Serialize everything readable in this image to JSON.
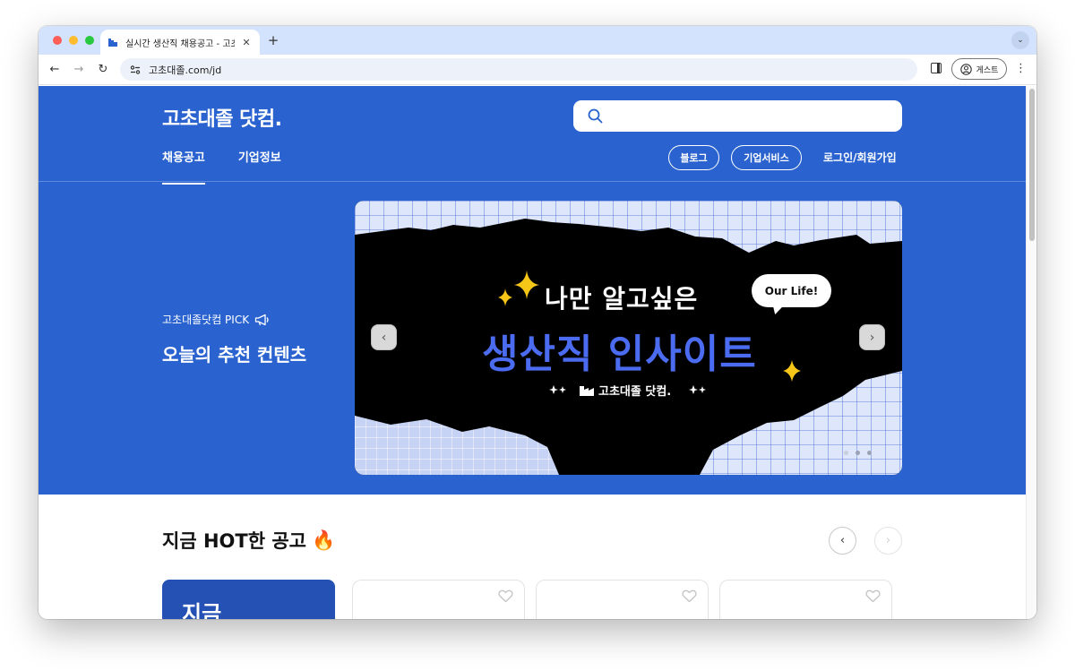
{
  "browser": {
    "tab_title": "실시간 생산직 채용공고 - 고초대졸",
    "tab_close": "✕",
    "new_tab": "+",
    "tab_search": "⌄",
    "url": "고초대졸.com/jd",
    "profile_label": "게스트",
    "menu": "⋮",
    "back": "←",
    "forward": "→",
    "reload": "↻"
  },
  "header": {
    "logo": "고초대졸 닷컴.",
    "search_placeholder": "",
    "nav": [
      "채용공고",
      "기업정보"
    ],
    "blog": "블로그",
    "biz": "기업서비스",
    "login": "로그인/회원가입"
  },
  "hero": {
    "pick_label": "고초대졸닷컴 PICK",
    "pick_title": "오늘의 추천 컨텐츠",
    "banner_line1": "나만 알고싶은",
    "banner_line2": "생산직 인사이트",
    "banner_brand": "고초대졸 닷컴.",
    "banner_bubble": "Our Life!",
    "prev": "‹",
    "next": "›",
    "slide_index": 1,
    "slide_count": 3
  },
  "hot": {
    "title": "지금 HOT한 공고",
    "emoji": "🔥",
    "prev": "‹",
    "next": "›",
    "featured_card_text": "지금"
  },
  "colors": {
    "hero_bg": "#2a63cf",
    "accent_text": "#4b6bf0",
    "sparkle": "#f5c518"
  }
}
